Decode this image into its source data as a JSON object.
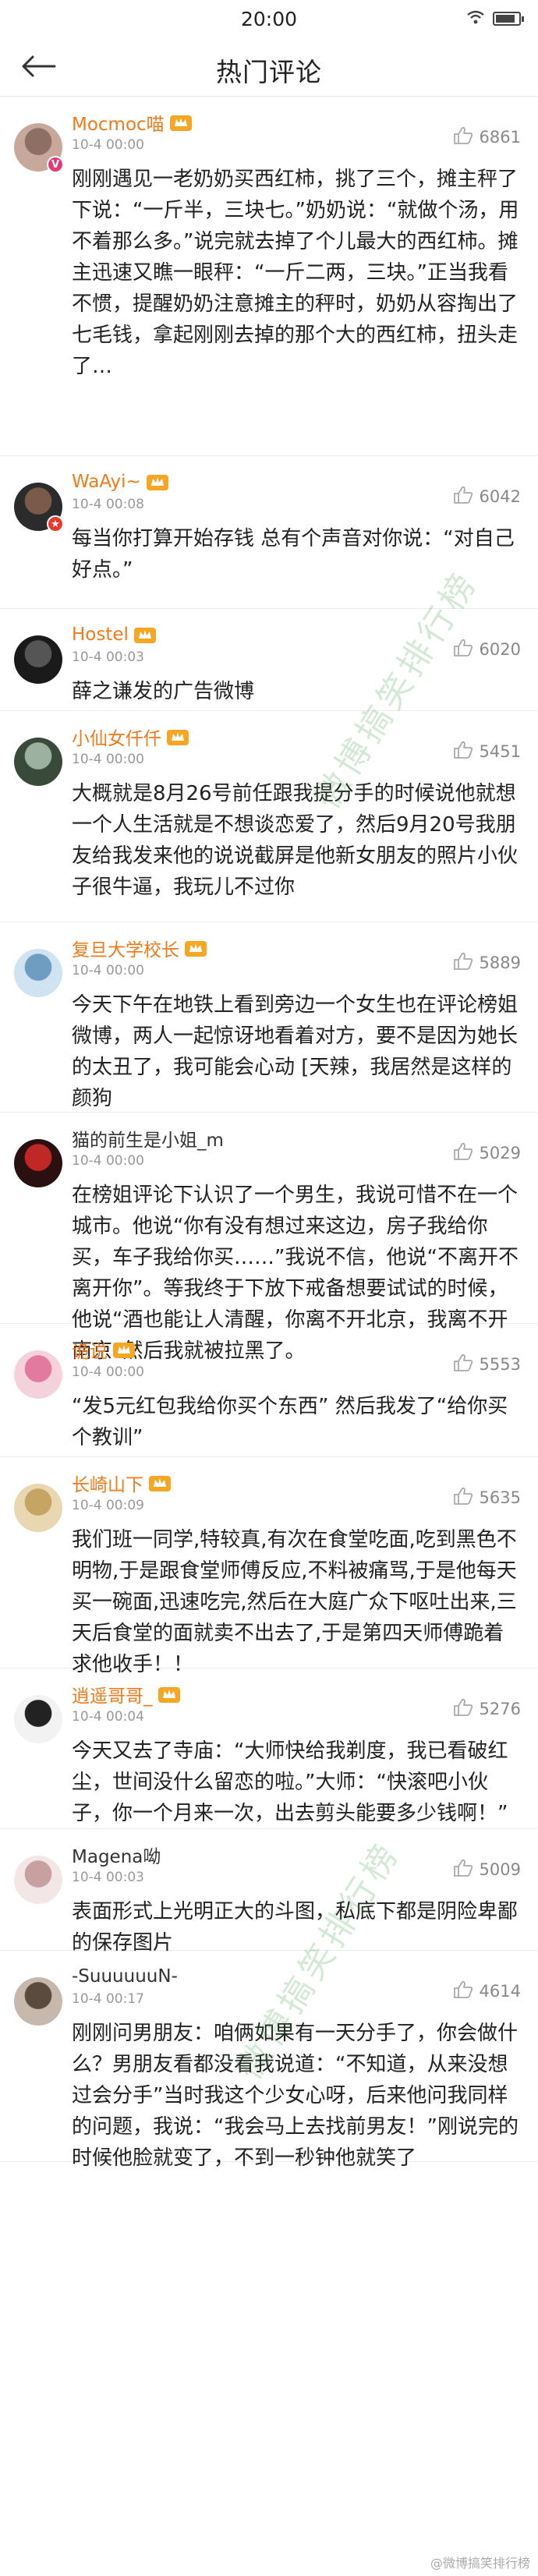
{
  "status_bar": {
    "time": "20:00"
  },
  "nav": {
    "title": "热门评论"
  },
  "watermark": {
    "text": "微博搞笑排行榜"
  },
  "footer": {
    "credit": "@微博搞笑排行榜"
  },
  "comments": [
    {
      "user": "Mocmoc喵",
      "time": "10-4 00:00",
      "likes": "6861",
      "text": "刚刚遇见一老奶奶买西红柿，挑了三个，摊主秤了下说：“一斤半，三块七。”奶奶说：“就做个汤，用不着那么多。”说完就去掉了个儿最大的西红柿。摊主迅速又瞧一眼秤：“一斤二两，三块。”正当我看不惯，提醒奶奶注意摊主的秤时，奶奶从容掏出了七毛钱，拿起刚刚去掉的那个大的西红柿，扭头走了…",
      "badge": "v"
    },
    {
      "user": "WaAyi~",
      "time": "10-4 00:08",
      "likes": "6042",
      "text": "每当你打算开始存钱 总有个声音对你说：“对自己好点。”",
      "badge": "r"
    },
    {
      "user": "Hostel",
      "time": "10-4 00:03",
      "likes": "6020",
      "text": "薛之谦发的广告微博"
    },
    {
      "user": "小仙女仟仟",
      "time": "10-4 00:00",
      "likes": "5451",
      "text": "大概就是8月26号前任跟我提分手的时候说他就想一个人生活就是不想谈恋爱了，然后9月20号我朋友给我发来他的说说截屏是他新女朋友的照片小伙子很牛逼，我玩儿不过你"
    },
    {
      "user": "复旦大学校长",
      "time": "10-4 00:00",
      "likes": "5889",
      "text": "今天下午在地铁上看到旁边一个女生也在评论榜姐微博，两人一起惊讶地看着对方，要不是因为她长的太丑了，我可能会心动 [天辣，我居然是这样的颜狗"
    },
    {
      "user": "猫的前生是小姐_m",
      "time": "10-4 00:00",
      "likes": "5029",
      "text": "在榜姐评论下认识了一个男生，我说可惜不在一个城市。他说“你有没有想过来这边，房子我给你买，车子我给你买……”我说不信，他说“不离开不离开你”。等我终于下放下戒备想要试试的时候，他说“酒也能让人清醒，你离不开北京，我离不开南京”然后我就被拉黑了。"
    },
    {
      "user": "诡说",
      "time": "10-4 00:00",
      "likes": "5553",
      "text": "“发5元红包我给你买个东西” 然后我发了“给你买个教训”"
    },
    {
      "user": "长崎山下",
      "time": "10-4 00:09",
      "likes": "5635",
      "text": "我们班一同学,特较真,有次在食堂吃面,吃到黑色不明物,于是跟食堂师傅反应,不料被痛骂,于是他每天买一碗面,迅速吃完,然后在大庭广众下呕吐出来,三天后食堂的面就卖不出去了,于是第四天师傅跪着求他收手！！"
    },
    {
      "user": "逍遥哥哥_",
      "time": "10-4 00:04",
      "likes": "5276",
      "text": "今天又去了寺庙：“大师快给我剃度，我已看破红尘，世间没什么留恋的啦。”大师：“快滚吧小伙子，你一个月来一次，出去剪头能要多少钱啊！”"
    },
    {
      "user": "Magena呦",
      "time": "10-4 00:03",
      "likes": "5009",
      "text": "表面形式上光明正大的斗图，私底下都是阴险卑鄙的保存图片"
    },
    {
      "user": "-SuuuuuuN-",
      "time": "10-4 00:17",
      "likes": "4614",
      "text": "刚刚问男朋友：咱俩如果有一天分手了，你会做什么？男朋友看都没看我说道：“不知道，从来没想过会分手”当时我这个少女心呀，后来他问我同样的问题，我说：“我会马上去找前男友！”刚说完的时候他脸就变了，不到一秒钟他就笑了"
    }
  ]
}
